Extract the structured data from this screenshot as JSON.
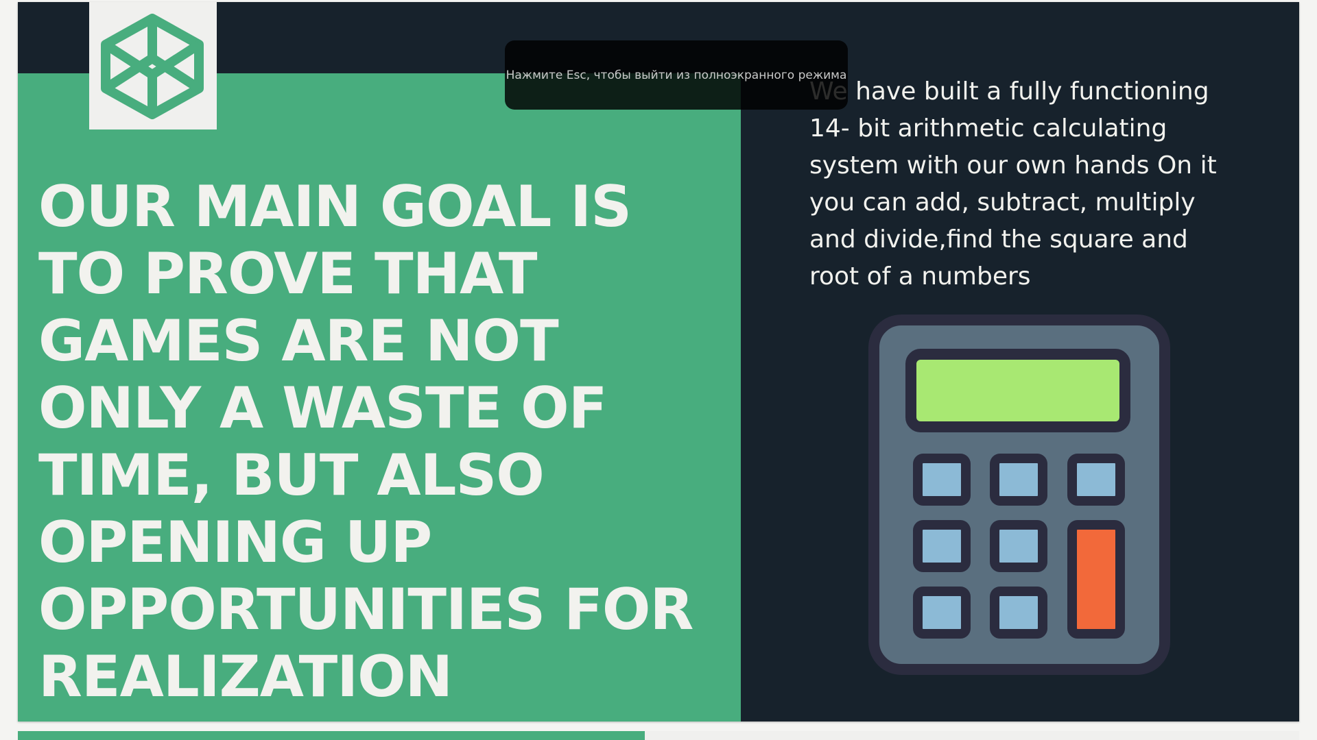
{
  "fullscreen_toast": {
    "text": "Нажмите Esc, чтобы выйти из полноэкранного режима"
  },
  "slide": {
    "headline": "OUR MAIN GOAL IS TO PROVE THAT GAMES ARE NOT ONLY A WASTE OF TIME, BUT ALSO OPENING UP OPPORTUNITIES FOR REALIZATION",
    "description": "We have built a fully functioning 14- bit arithmetic calculating system with our own hands On it you can add, subtract, multiply and divide,find the square and root of a numbers",
    "logo_icon": "codepen-hexagon-icon",
    "illustration_icon": "calculator-icon"
  },
  "colors": {
    "green": "#48ad7e",
    "dark": "#17222c",
    "text": "#f2f2ee",
    "calculator_body": "#5a6f7f",
    "calculator_outline": "#2b2c3f",
    "screen": "#a8e872",
    "key": "#8cbad6",
    "equals_key": "#f2693a"
  }
}
